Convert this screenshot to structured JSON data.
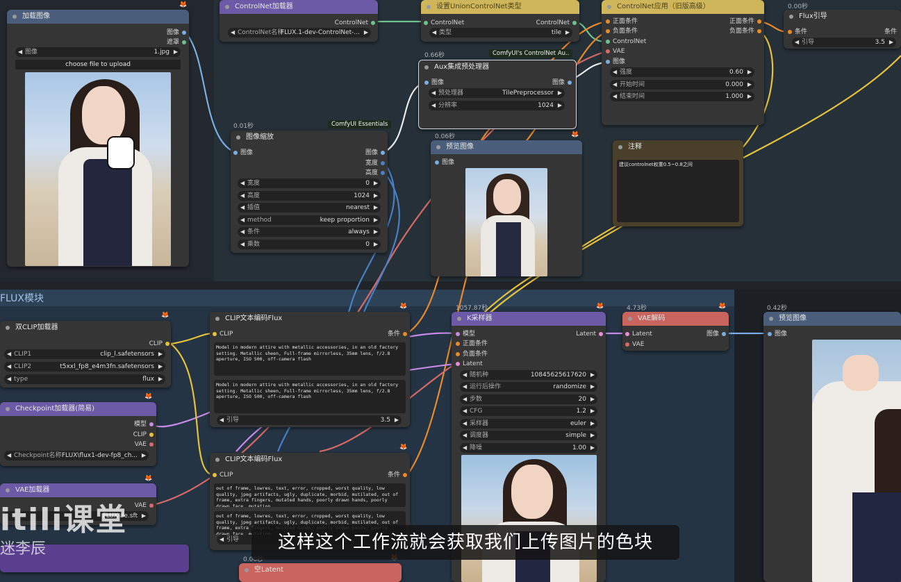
{
  "groups": {
    "flux_title": "FLUX模块"
  },
  "colors": {
    "wire_blue": "#78aee0",
    "wire_yellow": "#e6c13a",
    "wire_red": "#d56a66",
    "wire_green": "#6fc28e",
    "wire_purple": "#c58ae6",
    "wire_orange": "#e88a2a"
  },
  "load_image": {
    "title": "加载图像",
    "out_image": "图像",
    "out_mask": "遮罩",
    "widget_label": "图像",
    "widget_value": "1.jpg",
    "upload_button": "choose file to upload"
  },
  "controlnet_loader": {
    "title": "ControlNet加载器",
    "out": "ControlNet",
    "widget_label": "ControlNet名称",
    "widget_value": "FLUX.1-dev-ControlNet-..."
  },
  "union_type": {
    "title": "设置UnionControlNet类型",
    "in": "ControlNet",
    "out": "ControlNet",
    "widget_label": "类型",
    "widget_value": "tile"
  },
  "apply_controlnet": {
    "title": "ControlNet应用（旧版高级）",
    "in_pos": "正面条件",
    "in_neg": "负面条件",
    "in_cn": "ControlNet",
    "in_vae": "VAE",
    "in_img": "图像",
    "out_pos": "正面条件",
    "out_neg": "负面条件",
    "widgets": [
      {
        "label": "强度",
        "value": "0.60"
      },
      {
        "label": "开始时间",
        "value": "0.000"
      },
      {
        "label": "结束时间",
        "value": "1.000"
      }
    ]
  },
  "flux_guidance": {
    "timing": "0.00秒",
    "title": "Flux引导",
    "in": "条件",
    "out": "条件",
    "widget_label": "引导",
    "widget_value": "3.5"
  },
  "aux": {
    "timing": "0.66秒",
    "badge": "ComfyUI's ControlNet Au..",
    "title": "Aux集成预处理器",
    "in": "图像",
    "out": "图像",
    "widgets": [
      {
        "label": "预处理器",
        "value": "TilePreprocessor"
      },
      {
        "label": "分辨率",
        "value": "1024"
      }
    ]
  },
  "resize": {
    "timing": "0.01秒",
    "badge": "ComfyUI Essentials",
    "title": "图像缩放",
    "in": "图像",
    "out_image": "图像",
    "out_width": "宽度",
    "out_height": "高度",
    "widgets": [
      {
        "label": "宽度",
        "value": "0"
      },
      {
        "label": "高度",
        "value": "1024"
      },
      {
        "label": "插值",
        "value": "nearest"
      },
      {
        "label": "method",
        "value": "keep proportion"
      },
      {
        "label": "条件",
        "value": "always"
      },
      {
        "label": "乘数",
        "value": "0"
      }
    ]
  },
  "preview1": {
    "timing": "0.06秒",
    "title": "预览图像",
    "in": "图像"
  },
  "note": {
    "title": "注释",
    "text": "建议controlnet权重0.5~0.8之间"
  },
  "dual_clip": {
    "title": "双CLIP加载器",
    "out": "CLIP",
    "widgets": [
      {
        "label": "CLIP1",
        "value": "clip_l.safetensors"
      },
      {
        "label": "CLIP2",
        "value": "t5xxl_fp8_e4m3fn.safetensors"
      },
      {
        "label": "type",
        "value": "flux"
      }
    ]
  },
  "checkpoint": {
    "title": "Checkpoint加载器(简易)",
    "out_model": "模型",
    "out_clip": "CLIP",
    "out_vae": "VAE",
    "widget_label": "Checkpoint名称",
    "widget_value": "FLUX\\flux1-dev-fp8_ch..."
  },
  "vae_loader": {
    "title": "VAE加载器",
    "out": "VAE",
    "widget_value": "FLUX-ae.sft"
  },
  "clip_pos": {
    "title": "CLIP文本编码Flux",
    "in": "CLIP",
    "out": "条件",
    "text1": "Model in modern attire with metallic accessories, in an old factory setting. Metallic sheen, Full-frame mirrorless, 35mm lens, f/2.8 aperture, ISO 500, off-camera flash",
    "text2": "Model in modern attire with metallic accessories, in an old factory setting. Metallic sheen, Full-frame mirrorless, 35mm lens, f/2.8 aperture, ISO 500, off-camera flash",
    "widget_label": "引导",
    "widget_value": "3.5"
  },
  "clip_neg": {
    "title": "CLIP文本编码Flux",
    "in": "CLIP",
    "out": "条件",
    "text1": "out of frame, lowres, text, error, cropped, worst quality, low quality, jpeg artifacts, ugly, duplicate, morbid, mutilated, out of frame, extra fingers, mutated hands, poorly drawn hands, poorly drawn face, mutation,",
    "text2": "out of frame, lowres, text, error, cropped, worst quality, low quality, jpeg artifacts, ugly, duplicate, morbid, mutilated, out of frame, extra fingers, mutated hands, poorly drawn hands, poorly drawn face, mutation,",
    "widget_label": "引导"
  },
  "ksampler": {
    "timing": "1057.87秒",
    "title": "K采样器",
    "in_model": "模型",
    "in_pos": "正面条件",
    "in_neg": "负面条件",
    "in_latent": "Latent",
    "out": "Latent",
    "widgets": [
      {
        "label": "随机种",
        "value": "10845625617620"
      },
      {
        "label": "运行后操作",
        "value": "randomize"
      },
      {
        "label": "步数",
        "value": "20"
      },
      {
        "label": "CFG",
        "value": "1.2"
      },
      {
        "label": "采样器",
        "value": "euler"
      },
      {
        "label": "调度器",
        "value": "simple"
      },
      {
        "label": "降噪",
        "value": "1.00"
      }
    ]
  },
  "vae_decode": {
    "timing": "4.73秒",
    "title": "VAE解码",
    "in_latent": "Latent",
    "in_vae": "VAE",
    "out": "图像"
  },
  "preview2": {
    "timing": "0.42秒",
    "title": "预览图像",
    "in": "图像"
  },
  "empty_latent": {
    "timing": "0.00秒",
    "title": "空Latent"
  },
  "watermark": {
    "logo": "itili课堂",
    "author": "迷李辰"
  },
  "subtitle": "这样这个工作流就会获取我们上传图片的色块"
}
